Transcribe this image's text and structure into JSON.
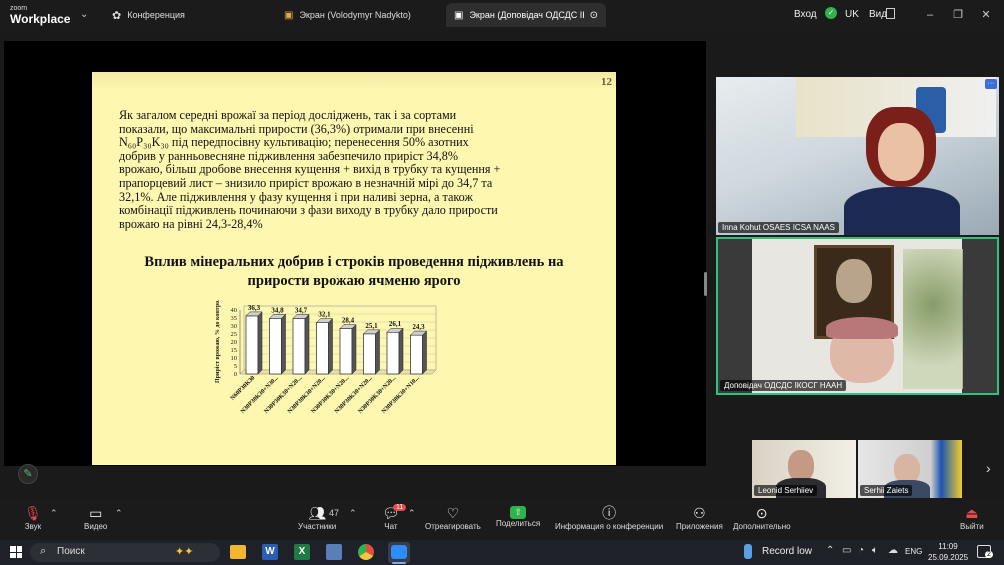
{
  "app": {
    "logo_small": "zoom",
    "logo_big": "Workplace"
  },
  "tabs": [
    {
      "label": "Конференция"
    },
    {
      "label": "Экран (Volodymyr Nadykto)"
    },
    {
      "label": "Экран (Доповідач ОДСДС ІКОСГ"
    }
  ],
  "header_right": {
    "signin": "Вход",
    "lang": "UK",
    "view": "Вид"
  },
  "slide": {
    "number": "12",
    "paragraph_lines": [
      "Як загалом середні врожаї за період досліджень, так  і за сортами",
      "показали, що максимальні прирости (36,3%) отримали при внесенні",
      "N₆₀P₃₀K₃₀ під передпосівну культивацію; перенесення 50% азотних",
      "добрив у ранньовесняне підживлення забезпечило приріст 34,8%",
      "врожаю, більш дробове внесення кущення + вихід в трубку та кущення +",
      "прапорцевий лист – знизило приріст врожаю в незначній мірі до 34,7 та",
      "32,1%. Але підживлення у фазу кущення і при наливі зерна, а також",
      "комбінації підживлень починаючи з фази виходу в трубку дало прирости",
      "врожаю на рівні 24,3-28,4%"
    ],
    "title_line1": "Вплив мінеральних добрив і строків проведення підживлень на",
    "title_line2": "прирости врожаю ячменю ярого"
  },
  "chart_data": {
    "type": "bar",
    "ylabel": "Приріст врожаю, % до контролю",
    "ylim": [
      0,
      40
    ],
    "yticks": [
      "0",
      "5",
      "10",
      "15",
      "20",
      "25",
      "30",
      "35",
      "40"
    ],
    "categories": [
      "N60P30K30",
      "N30P30K30+N30...",
      "N30P30K30+N20...",
      "N30P30K30+N20...",
      "N30P30K30+N20...",
      "N30P30K30+N20...",
      "N30P30K30+N20...",
      "N30P30K30+N10..."
    ],
    "values": [
      36.3,
      34.8,
      34.7,
      32.1,
      28.4,
      25.1,
      26.1,
      24.3
    ],
    "value_labels": [
      "36,3",
      "34,8",
      "34,7",
      "32,1",
      "28,4",
      "25,1",
      "26,1",
      "24,3"
    ]
  },
  "participants": [
    {
      "name": "Inna Kohut OSAES ICSA NAAS"
    },
    {
      "name": "Доповідач ОДСДС ІКОСГ НААН"
    },
    {
      "name": "Leonid Serhiiev"
    },
    {
      "name": "Serhii Zaiets"
    }
  ],
  "toolbar": {
    "audio": "Звук",
    "video": "Видео",
    "participants": "Участники",
    "participants_count": "47",
    "chat": "Чат",
    "chat_badge": "11",
    "react": "Отреагировать",
    "share": "Поделиться",
    "info": "Информация о конференции",
    "apps": "Приложения",
    "more": "Дополнительно",
    "leave": "Выйти"
  },
  "taskbar": {
    "search": "Поиск",
    "record": "Record low",
    "lang": "ENG",
    "time": "11:09",
    "date": "25.09.2025",
    "notif": "2"
  }
}
